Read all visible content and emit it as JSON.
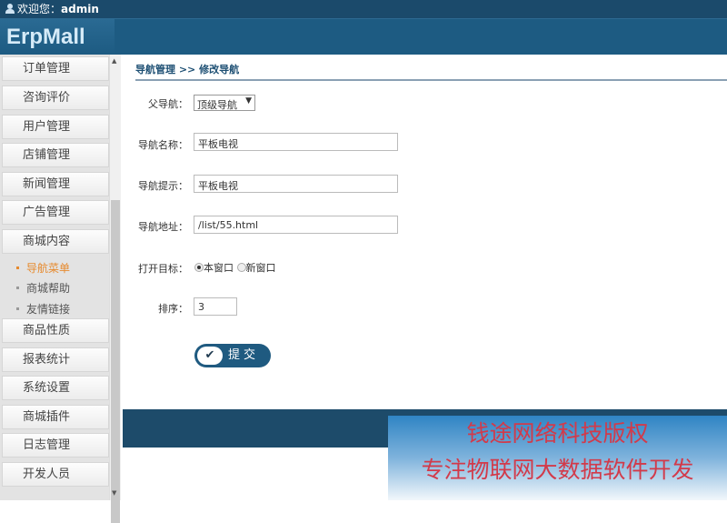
{
  "topbar": {
    "welcome": "欢迎您：",
    "user": "admin"
  },
  "logo": "ErpMall",
  "sidebar": {
    "items": [
      "订单管理",
      "咨询评价",
      "用户管理",
      "店铺管理",
      "新闻管理",
      "广告管理",
      "商城内容",
      "商品性质",
      "报表统计",
      "系统设置",
      "商城插件",
      "日志管理",
      "开发人员"
    ],
    "sub": [
      "导航菜单",
      "商城帮助",
      "友情链接"
    ]
  },
  "breadcrumb": "导航管理 >> 修改导航",
  "form": {
    "parent_label": "父导航：",
    "parent_value": "顶级导航",
    "name_label": "导航名称：",
    "name_value": "平板电视",
    "tip_label": "导航提示：",
    "tip_value": "平板电视",
    "url_label": "导航地址：",
    "url_value": "/list/55.html",
    "target_label": "打开目标：",
    "target_opt1": "本窗口",
    "target_opt2": "新窗口",
    "order_label": "排序：",
    "order_value": "3",
    "submit": "提交"
  },
  "watermark": {
    "line1": "钱途网络科技版权",
    "line2": "专注物联网大数据软件开发"
  }
}
